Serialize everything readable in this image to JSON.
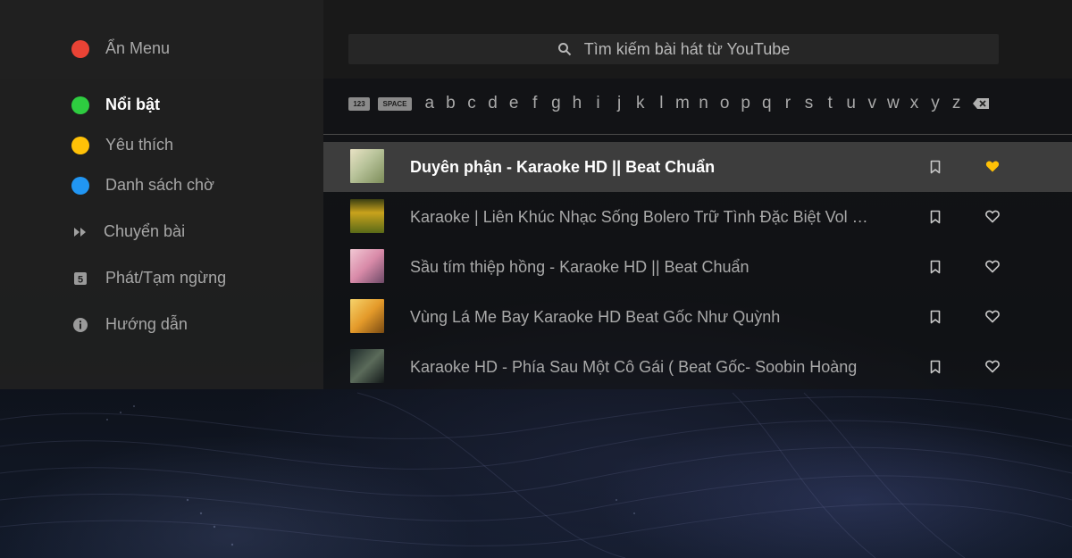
{
  "colors": {
    "red": "#ea4335",
    "green": "#2ecc40",
    "yellow": "#ffc107",
    "blue": "#2196f3",
    "heart_active": "#ffc107"
  },
  "menu": {
    "hide": {
      "label": "Ẩn Menu",
      "icon": "red-dot-icon"
    },
    "featured": {
      "label": "Nổi bật",
      "icon": "green-dot-icon"
    },
    "favorites": {
      "label": "Yêu thích",
      "icon": "yellow-dot-icon"
    },
    "queue": {
      "label": "Danh sách chờ",
      "icon": "blue-dot-icon"
    },
    "skip": {
      "label": "Chuyển bài",
      "icon": "fast-forward-icon"
    },
    "play_pause": {
      "label": "Phát/Tạm ngừng",
      "icon": "play-pause-key-icon"
    },
    "help": {
      "label": "Hướng dẫn",
      "icon": "info-icon"
    }
  },
  "search": {
    "placeholder": "Tìm kiếm bài hát từ YouTube",
    "icon": "search-icon"
  },
  "keyboard": {
    "numbers_key": "123",
    "space_key": "SPACE",
    "letters": [
      "a",
      "b",
      "c",
      "d",
      "e",
      "f",
      "g",
      "h",
      "i",
      "j",
      "k",
      "l",
      "m",
      "n",
      "o",
      "p",
      "q",
      "r",
      "s",
      "t",
      "u",
      "v",
      "w",
      "x",
      "y",
      "z"
    ],
    "backspace_icon": "backspace-icon"
  },
  "songs": [
    {
      "title": "Duyên phận - Karaoke HD || Beat Chuẩn",
      "favorited": true
    },
    {
      "title": "Karaoke | Liên Khúc Nhạc Sống Bolero Trữ Tình Đặc Biệt Vol 1…",
      "favorited": false
    },
    {
      "title": "Sầu tím thiệp hồng - Karaoke HD || Beat Chuẩn",
      "favorited": false
    },
    {
      "title": "Vùng Lá Me Bay   Karaoke HD   Beat Gốc Như Quỳnh",
      "favorited": false
    },
    {
      "title": "Karaoke HD - Phía Sau Một Cô Gái ( Beat Gốc- Soobin Hoàng",
      "favorited": false
    }
  ]
}
